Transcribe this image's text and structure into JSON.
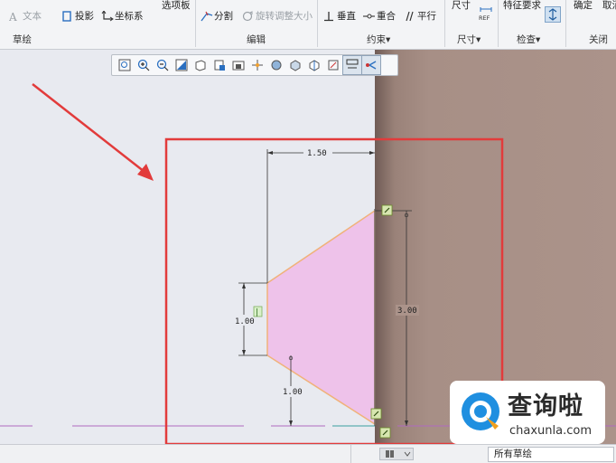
{
  "ribbon": {
    "items": {
      "text": "文本",
      "project": "投影",
      "coord": "坐标系",
      "palette": "选项板",
      "divide": "分割",
      "rotate_resize": "旋转调整大小",
      "vertical": "垂直",
      "coincident": "重合",
      "parallel": "平行",
      "dimension": "尺寸",
      "ref_badge": "REF",
      "feature_req": "特征要求",
      "ok": "确定",
      "cancel": "取消"
    },
    "groups": {
      "sketch": "草绘",
      "edit": "编辑",
      "constrain": "约束▾",
      "dimension": "尺寸▾",
      "inspect": "检查▾",
      "close": "关闭"
    }
  },
  "sketch": {
    "dim_top": "1.50",
    "dim_left": "1.00",
    "dim_bottom": "1.00",
    "dim_right": "3.00",
    "constraint_v": "|",
    "shape_color": "#eec2ea",
    "outline_color": "#f0b27a",
    "highlight_color": "#e23b3b"
  },
  "statusbar": {
    "filter": "所有草绘"
  },
  "logo": {
    "cn": "查询啦",
    "en": "chaxunla.com"
  }
}
